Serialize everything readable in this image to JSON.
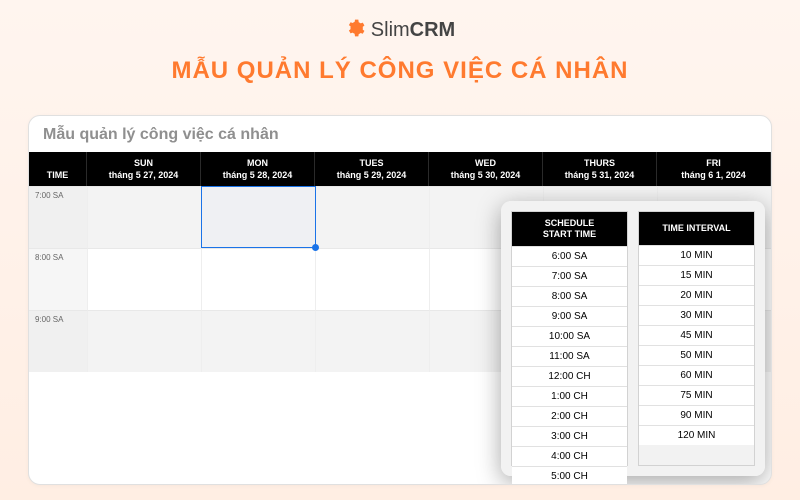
{
  "brand": {
    "name_a": "Slim",
    "name_b": "CRM",
    "accent": "#ff7a2f"
  },
  "headline": "MẪU QUẢN LÝ CÔNG VIỆC CÁ NHÂN",
  "card_title": "Mẫu quản lý công việc cá nhân",
  "time_header": "TIME",
  "days": [
    {
      "dow": "SUN",
      "date": "tháng 5 27, 2024"
    },
    {
      "dow": "MON",
      "date": "tháng 5 28, 2024"
    },
    {
      "dow": "TUES",
      "date": "tháng 5 29, 2024"
    },
    {
      "dow": "WED",
      "date": "tháng 5 30, 2024"
    },
    {
      "dow": "THURS",
      "date": "tháng 5 31, 2024"
    },
    {
      "dow": "FRI",
      "date": "tháng 6 1, 2024"
    }
  ],
  "hours": [
    "7:00 SA",
    "8:00 SA",
    "9:00 SA"
  ],
  "popover": {
    "start_header": "SCHEDULE\nSTART TIME",
    "interval_header": "TIME INTERVAL",
    "start_options": [
      "6:00 SA",
      "7:00 SA",
      "8:00 SA",
      "9:00 SA",
      "10:00 SA",
      "11:00 SA",
      "12:00 CH",
      "1:00 CH",
      "2:00 CH",
      "3:00 CH",
      "4:00 CH",
      "5:00 CH"
    ],
    "interval_options": [
      "10 MIN",
      "15 MIN",
      "20 MIN",
      "30 MIN",
      "45 MIN",
      "50 MIN",
      "60 MIN",
      "75 MIN",
      "90 MIN",
      "120 MIN"
    ]
  }
}
